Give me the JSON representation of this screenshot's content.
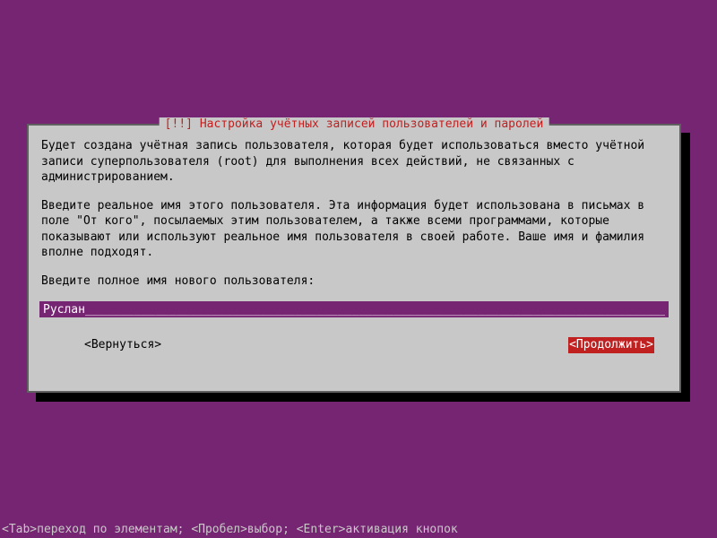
{
  "dialog": {
    "title_prefix": "[!!]",
    "title": "Настройка учётных записей пользователей и паролей",
    "para1": "Будет создана учётная запись пользователя, которая будет использоваться вместо учётной записи суперпользователя (root) для выполнения всех действий, не связанных с администрированием.",
    "para2": "Введите реальное имя этого пользователя. Эта информация будет использована в письмах в поле \"От кого\", посылаемых этим пользователем, а также всеми программами, которые показывают или используют реальное имя пользователя в своей работе. Ваше имя и фамилия вполне подходят.",
    "prompt": "Введите полное имя нового пользователя:",
    "input_value": "Руслан",
    "back_label": "<Вернуться>",
    "continue_label": "<Продолжить>"
  },
  "footer": {
    "hint": "<Tab>переход по элементам; <Пробел>выбор; <Enter>активация кнопок"
  }
}
